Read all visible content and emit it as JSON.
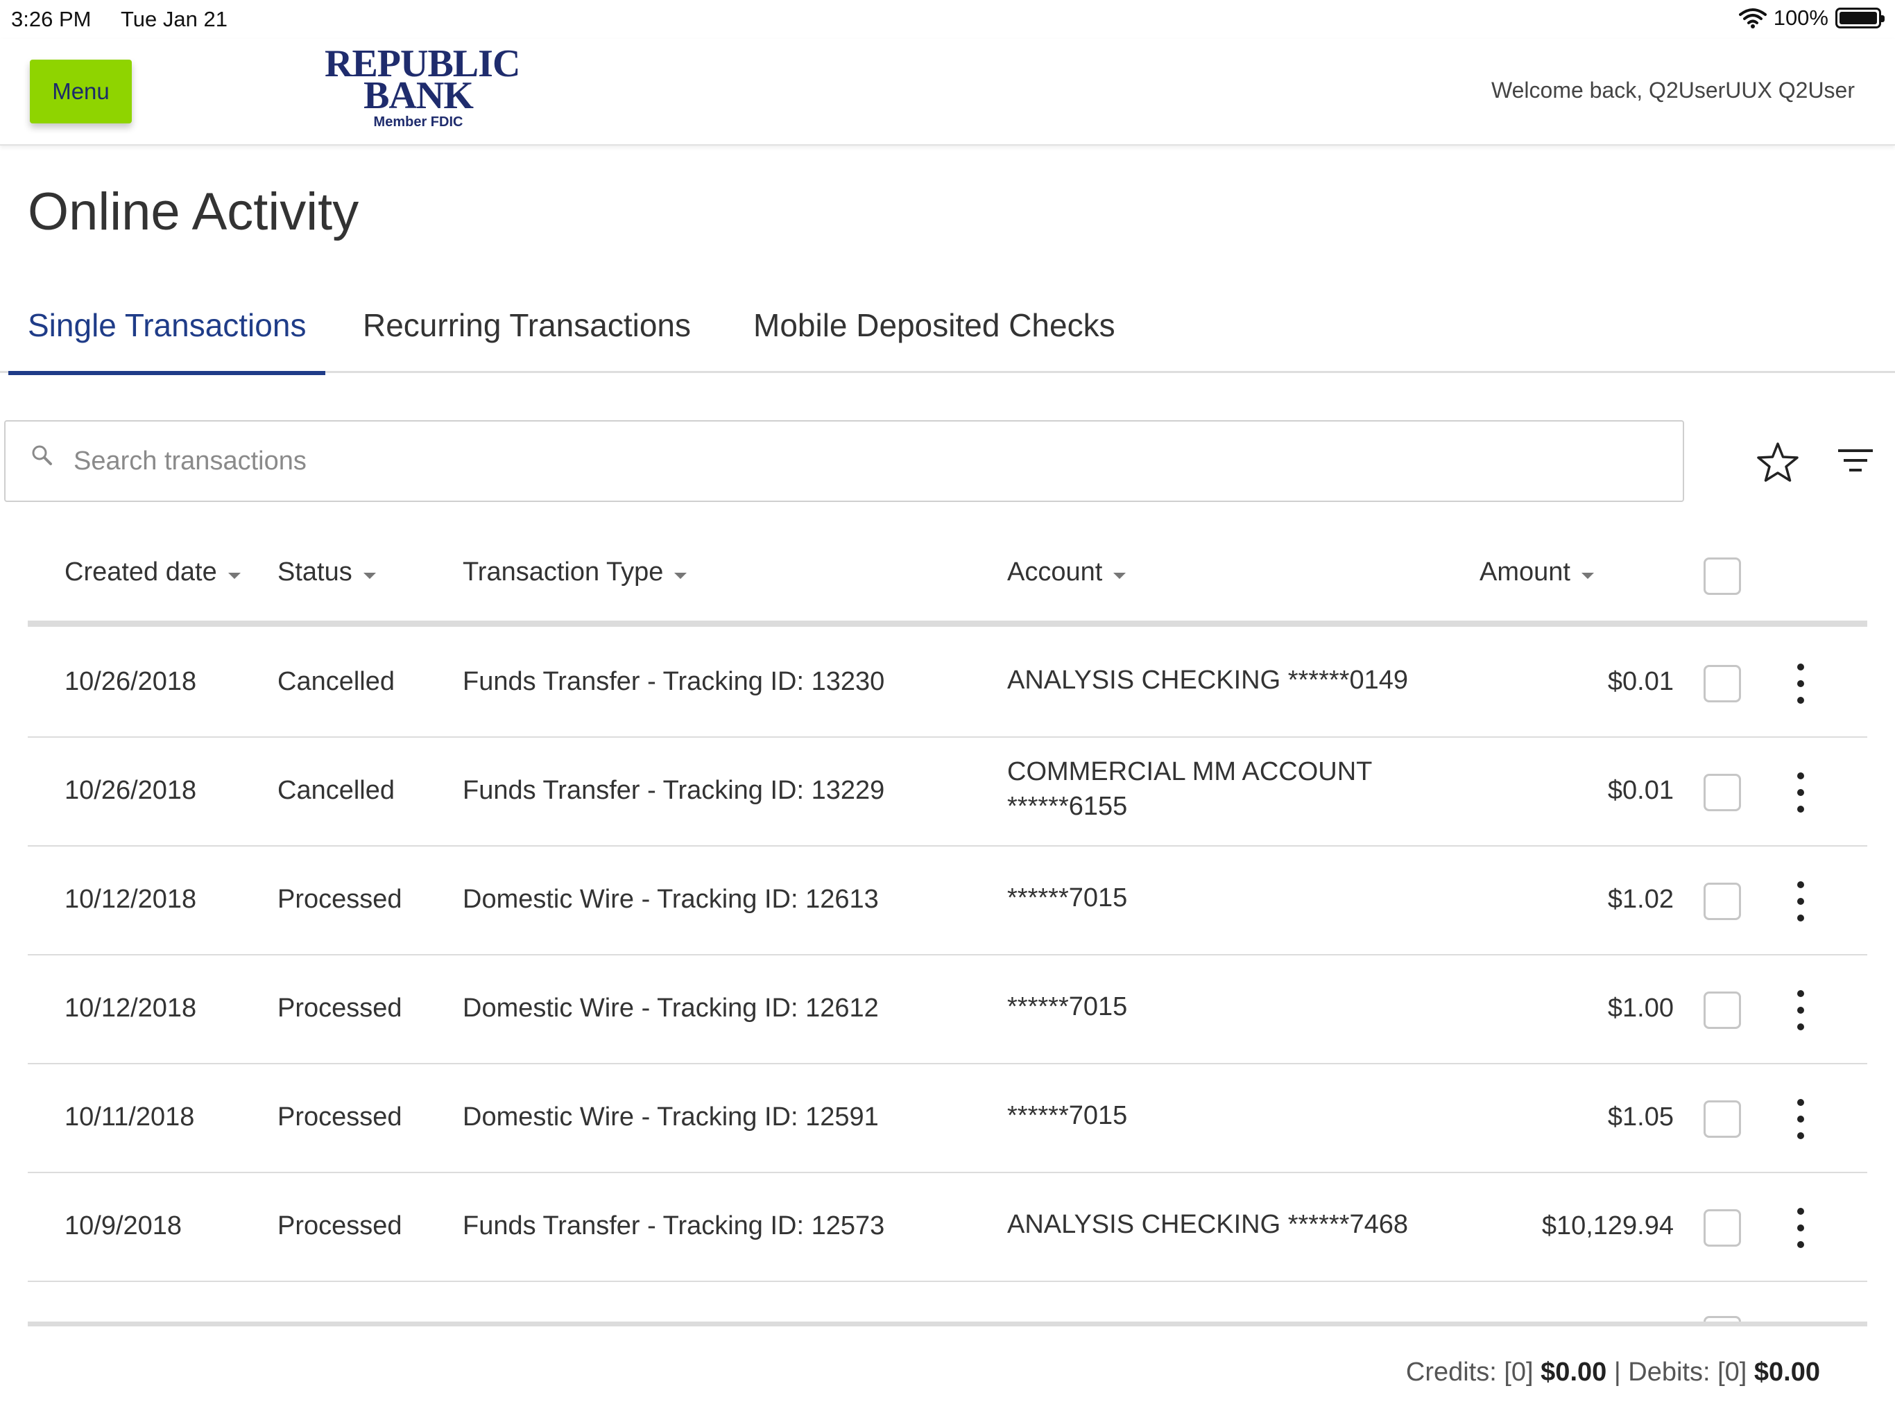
{
  "status_bar": {
    "time": "3:26 PM",
    "date": "Tue Jan 21",
    "battery": "100%"
  },
  "header": {
    "menu_label": "Menu",
    "logo_line1": "REPUBLIC",
    "logo_line2": "BANK",
    "logo_line3": "Member FDIC",
    "welcome": "Welcome back, Q2UserUUX Q2User",
    "colors": {
      "menu_button": "#8fd400",
      "brand": "#1f2c6d"
    }
  },
  "page": {
    "title": "Online Activity"
  },
  "tabs": [
    {
      "label": "Single Transactions",
      "active": true
    },
    {
      "label": "Recurring Transactions",
      "active": false
    },
    {
      "label": "Mobile Deposited Checks",
      "active": false
    }
  ],
  "search": {
    "placeholder": "Search transactions",
    "value": ""
  },
  "table": {
    "columns": {
      "created_date": "Created date",
      "status": "Status",
      "transaction_type": "Transaction Type",
      "account": "Account",
      "amount": "Amount"
    },
    "rows": [
      {
        "date": "10/26/2018",
        "status": "Cancelled",
        "type": "Funds Transfer - Tracking ID: 13230",
        "account_line1": "ANALYSIS CHECKING ******0149",
        "account_line2": "",
        "amount": "$0.01"
      },
      {
        "date": "10/26/2018",
        "status": "Cancelled",
        "type": "Funds Transfer - Tracking ID: 13229",
        "account_line1": "COMMERCIAL MM ACCOUNT",
        "account_line2": "******6155",
        "amount": "$0.01"
      },
      {
        "date": "10/12/2018",
        "status": "Processed",
        "type": "Domestic Wire - Tracking ID: 12613",
        "account_line1": "******7015",
        "account_line2": "",
        "amount": "$1.02"
      },
      {
        "date": "10/12/2018",
        "status": "Processed",
        "type": "Domestic Wire - Tracking ID: 12612",
        "account_line1": "******7015",
        "account_line2": "",
        "amount": "$1.00"
      },
      {
        "date": "10/11/2018",
        "status": "Processed",
        "type": "Domestic Wire - Tracking ID: 12591",
        "account_line1": "******7015",
        "account_line2": "",
        "amount": "$1.05"
      },
      {
        "date": "10/9/2018",
        "status": "Processed",
        "type": "Funds Transfer - Tracking ID: 12573",
        "account_line1": "ANALYSIS CHECKING ******7468",
        "account_line2": "",
        "amount": "$10,129.94"
      }
    ]
  },
  "totals": {
    "credits_label": "Credits: [0]",
    "credits_value": "$0.00",
    "separator": "|",
    "debits_label": "Debits: [0]",
    "debits_value": "$0.00"
  },
  "icons": {
    "search": "search-icon",
    "favorite": "star-icon",
    "filter": "filter-icon",
    "row_menu": "kebab-icon",
    "wifi": "wifi-icon",
    "battery": "battery-icon"
  }
}
